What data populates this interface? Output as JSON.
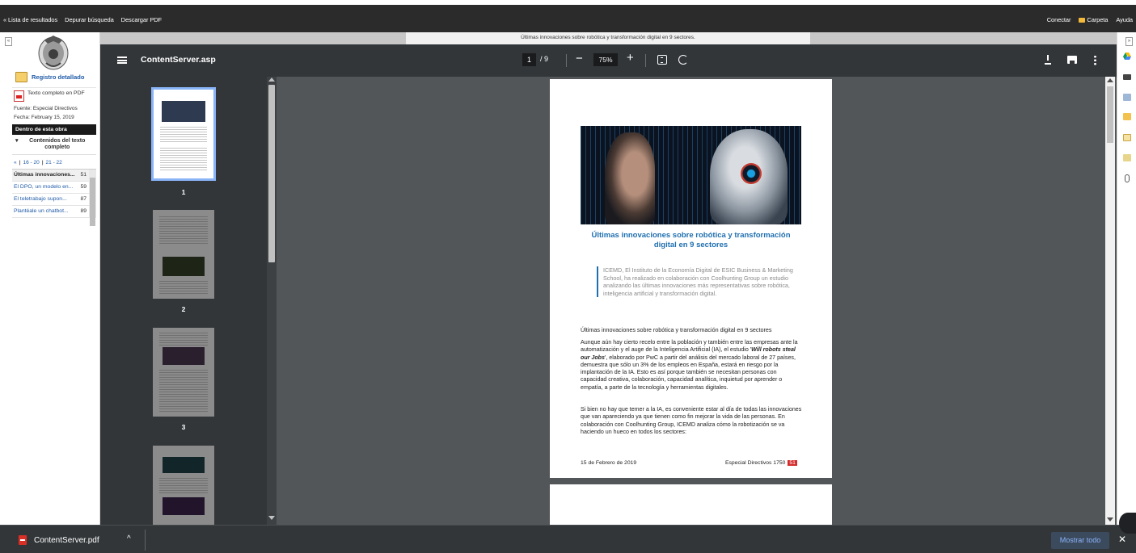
{
  "topbar": {
    "left_links": [
      "« Lista de resultados",
      "Depurar búsqueda",
      "Descargar PDF"
    ],
    "right_links": [
      "Conectar",
      "Carpeta",
      "Ayuda"
    ]
  },
  "left_panel": {
    "collapse_label": "«",
    "registro_label": "Registro detallado",
    "pdf_label": "Texto completo en PDF",
    "fuente": "Fuente: Especial Directivos",
    "fecha": "Fecha: February 15, 2019",
    "section_title": "Dentro de esta obra",
    "contents_label": "Contenidos del texto completo",
    "pager": {
      "prev": "«",
      "range1": "16 - 20",
      "range2": "21 - 22"
    },
    "toc": [
      {
        "title": "Últimas innovaciones...",
        "page": "51",
        "active": true
      },
      {
        "title": "El DPO, un modelo en...",
        "page": "59",
        "active": false
      },
      {
        "title": "El teletrabajo supon...",
        "page": "87",
        "active": false
      },
      {
        "title": "Plantéale un chatbot...",
        "page": "89",
        "active": false
      }
    ]
  },
  "viewer": {
    "doc_title": "Últimas innovaciones sobre robótica y transformación digital en 9 sectores.",
    "filename": "ContentServer.asp",
    "current_page": "1",
    "total_pages": "/ 9",
    "zoom": "75%",
    "thumb_numbers": [
      "1",
      "2",
      "3"
    ]
  },
  "page": {
    "title": "Últimas innovaciones sobre robótica y transformación digital en 9 sectores",
    "quote": "ICEMD, El Instituto de la Economía Digital de ESIC Business & Marketing School, ha realizado en colaboración con Coolhunting Group un estudio analizando las últimas innovaciones más representativas sobre robótica, inteligencia artificial y transformación digital.",
    "subtitle": "Últimas innovaciones sobre robótica y transformación digital en 9 sectores",
    "body_1_pre": "Aunque aún hay cierto recelo entre la población y también entre las empresas ante la automatización y el auge de la Inteligencia Artificial (IA), el estudio '",
    "body_1_em": "Will robots steal our Jobs",
    "body_1_post": "', elaborado por PwC a partir del análisis del mercado laboral de 27 países, demuestra que sólo un 3% de los empleos en España, estará en riesgo por la implantación de la IA. Esto es así porque también se necesitan personas con capacidad creativa, colaboración, capacidad analítica, inquietud por aprender o empatía, a parte de la tecnología y herramientas digitales.",
    "body_2": "Si bien no hay que temer a la IA, es conveniente estar al día de todas las innovaciones que van apareciendo ya que tienen como fin mejorar la vida de las personas. En colaboración con Coolhunting Group, ICEMD analiza cómo la robotización se va haciendo un hueco en todos los sectores:",
    "footer_date": "15 de Febrero de 2019",
    "footer_pub": "Especial Directivos 1750",
    "footer_page": "51"
  },
  "download_bar": {
    "file": "ContentServer.pdf",
    "caret": "^",
    "show_all": "Mostrar todo",
    "close": "✕"
  },
  "colors": {
    "link": "#1f5aa8",
    "accent_blue": "#1f6fb0",
    "pdf_red": "#d32b2b",
    "viewer_bg": "#525659",
    "toolbar_bg": "#323639"
  },
  "icons": {
    "topbar": [
      "folder-icon"
    ],
    "toolbar": [
      "menu-icon",
      "zoom-out-icon",
      "zoom-in-icon",
      "fit-page-icon",
      "rotate-icon",
      "download-icon",
      "print-icon",
      "more-icon"
    ],
    "right_rail": [
      "google-drive-icon",
      "print-icon",
      "image-icon",
      "folder-icon",
      "note-icon",
      "export-icon",
      "link-icon"
    ]
  }
}
